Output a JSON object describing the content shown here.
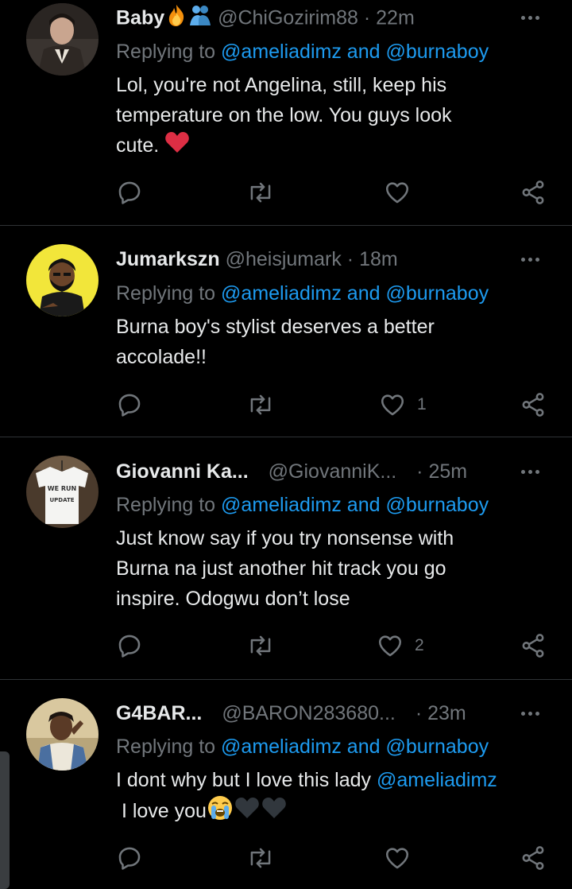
{
  "colors": {
    "background": "#000000",
    "primary_text": "#e7e9ea",
    "secondary_text": "#71767b",
    "link": "#1d9bf0",
    "divider": "#2f3336",
    "heart_red": "#e0245e"
  },
  "tweets": [
    {
      "name": "Baby",
      "name_emojis": [
        "fire-emoji",
        "hugging-people-emoji"
      ],
      "handle": "@ChiGozirim88",
      "sep": "·",
      "time": "22m",
      "replying_prefix": "Replying to",
      "reply_to_1": "@ameliadimz",
      "reply_and": "and",
      "reply_to_2": "@burnaboy",
      "text_line_1": "Lol, you're not Angelina, still, keep his",
      "text_line_2": "temperature on the low. You guys look",
      "text_line_3": "cute.",
      "text_emoji": "red-heart-emoji",
      "likes": ""
    },
    {
      "name": "Jumarkszn",
      "handle": "@heisjumark",
      "sep": "·",
      "time": "18m",
      "replying_prefix": "Replying to",
      "reply_to_1": "@ameliadimz",
      "reply_and": "and",
      "reply_to_2": "@burnaboy",
      "text_line_1": "Burna boy's stylist deserves a better",
      "text_line_2": "accolade!!",
      "likes": "1"
    },
    {
      "name": "Giovanni Ka...",
      "handle": "@GiovanniK...",
      "sep": "·",
      "time": "25m",
      "replying_prefix": "Replying to",
      "reply_to_1": "@ameliadimz",
      "reply_and": "and",
      "reply_to_2": "@burnaboy",
      "text_line_1": "Just know say if you try nonsense with",
      "text_line_2": "Burna na just another hit track you go",
      "text_line_3": "inspire. Odogwu don’t lose",
      "avatar_shirt_text_1": "WE RUN",
      "avatar_shirt_text_2": "UPDATE",
      "likes": "2"
    },
    {
      "name": "G4BAR...",
      "handle": "@BARON283680...",
      "sep": "·",
      "time": "23m",
      "replying_prefix": "Replying to",
      "reply_to_1": "@ameliadimz",
      "reply_and": "and",
      "reply_to_2": "@burnaboy",
      "text_line_1": "I dont why but I love this lady",
      "text_mention": "@ameliadimz",
      "text_line_2": "I love you",
      "text_emojis": [
        "loudly-crying-emoji",
        "black-heart-emoji",
        "black-heart-emoji"
      ],
      "likes": ""
    }
  ],
  "icons": {
    "reply": "reply-icon",
    "retweet": "retweet-icon",
    "like": "like-icon",
    "share": "share-icon",
    "more": "more-icon"
  }
}
